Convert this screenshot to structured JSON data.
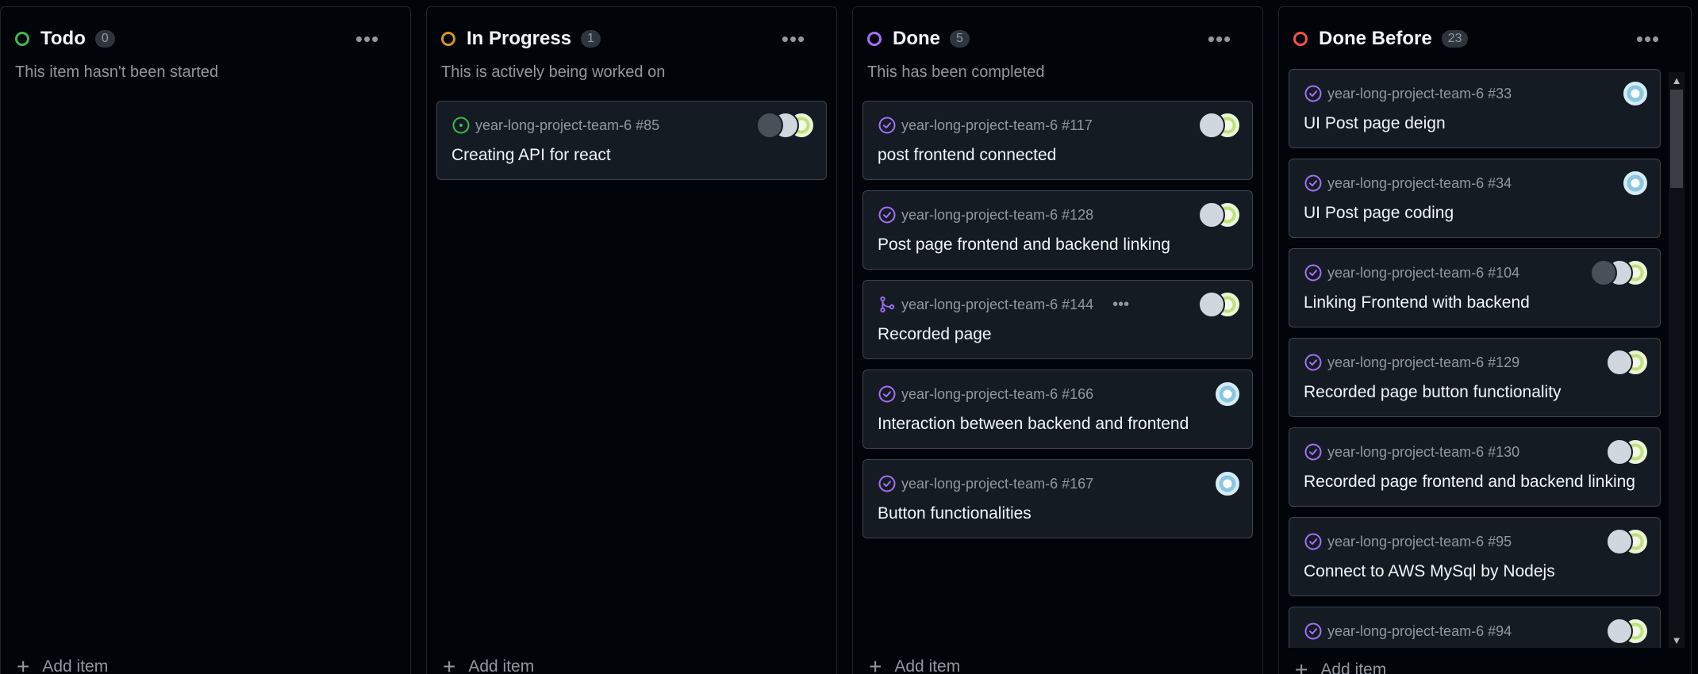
{
  "columns": [
    {
      "title": "Todo",
      "count": "0",
      "description": "This item hasn't been started",
      "status_color": "#3fb950",
      "menu_icon": "•••",
      "add_label": "Add item",
      "cards": []
    },
    {
      "title": "In Progress",
      "count": "1",
      "description": "This is actively being worked on",
      "status_color": "#d29922",
      "menu_icon": "•••",
      "add_label": "Add item",
      "cards": [
        {
          "ref": "year-long-project-team-6 #85",
          "title": "Creating API for react",
          "icon": "issue-open-icon",
          "avatars": [
            "gray",
            "white",
            "green"
          ]
        }
      ]
    },
    {
      "title": "Done",
      "count": "5",
      "description": "This has been completed",
      "status_color": "#a371f7",
      "menu_icon": "•••",
      "add_label": "Add item",
      "cards": [
        {
          "ref": "year-long-project-team-6 #117",
          "title": "post frontend connected",
          "icon": "issue-closed-icon",
          "avatars": [
            "white",
            "green"
          ]
        },
        {
          "ref": "year-long-project-team-6 #128",
          "title": "Post page frontend and backend linking",
          "icon": "issue-closed-icon",
          "avatars": [
            "white",
            "green"
          ]
        },
        {
          "ref": "year-long-project-team-6 #144",
          "title": "Recorded page",
          "icon": "pull-request-merged-icon",
          "avatars": [
            "white",
            "green"
          ],
          "kebab": "•••"
        },
        {
          "ref": "year-long-project-team-6 #166",
          "title": "Interaction between backend and frontend",
          "icon": "issue-closed-icon",
          "avatars": [
            "blue"
          ]
        },
        {
          "ref": "year-long-project-team-6 #167",
          "title": "Button functionalities",
          "icon": "issue-closed-icon",
          "avatars": [
            "blue"
          ]
        }
      ]
    },
    {
      "title": "Done Before",
      "count": "23",
      "description": "",
      "status_color": "#f85149",
      "menu_icon": "•••",
      "add_label": "Add item",
      "cards": [
        {
          "ref": "year-long-project-team-6 #33",
          "title": "UI Post page deign",
          "icon": "issue-closed-icon",
          "avatars": [
            "blue"
          ]
        },
        {
          "ref": "year-long-project-team-6 #34",
          "title": "UI Post page coding",
          "icon": "issue-closed-icon",
          "avatars": [
            "blue"
          ]
        },
        {
          "ref": "year-long-project-team-6 #104",
          "title": "Linking Frontend with backend",
          "icon": "issue-closed-icon",
          "avatars": [
            "gray",
            "white",
            "green"
          ]
        },
        {
          "ref": "year-long-project-team-6 #129",
          "title": "Recorded page button functionality",
          "icon": "issue-closed-icon",
          "avatars": [
            "white",
            "green"
          ]
        },
        {
          "ref": "year-long-project-team-6 #130",
          "title": "Recorded page frontend and backend linking",
          "icon": "issue-closed-icon",
          "avatars": [
            "white",
            "green"
          ]
        },
        {
          "ref": "year-long-project-team-6 #95",
          "title": "Connect to AWS MySql by Nodejs",
          "icon": "issue-closed-icon",
          "avatars": [
            "white",
            "green"
          ]
        },
        {
          "ref": "year-long-project-team-6 #94",
          "title": "",
          "icon": "issue-closed-icon",
          "avatars": [
            "white",
            "green"
          ]
        }
      ]
    }
  ],
  "scrollbar": {
    "up_arrow": "▲",
    "down_arrow": "▼"
  }
}
